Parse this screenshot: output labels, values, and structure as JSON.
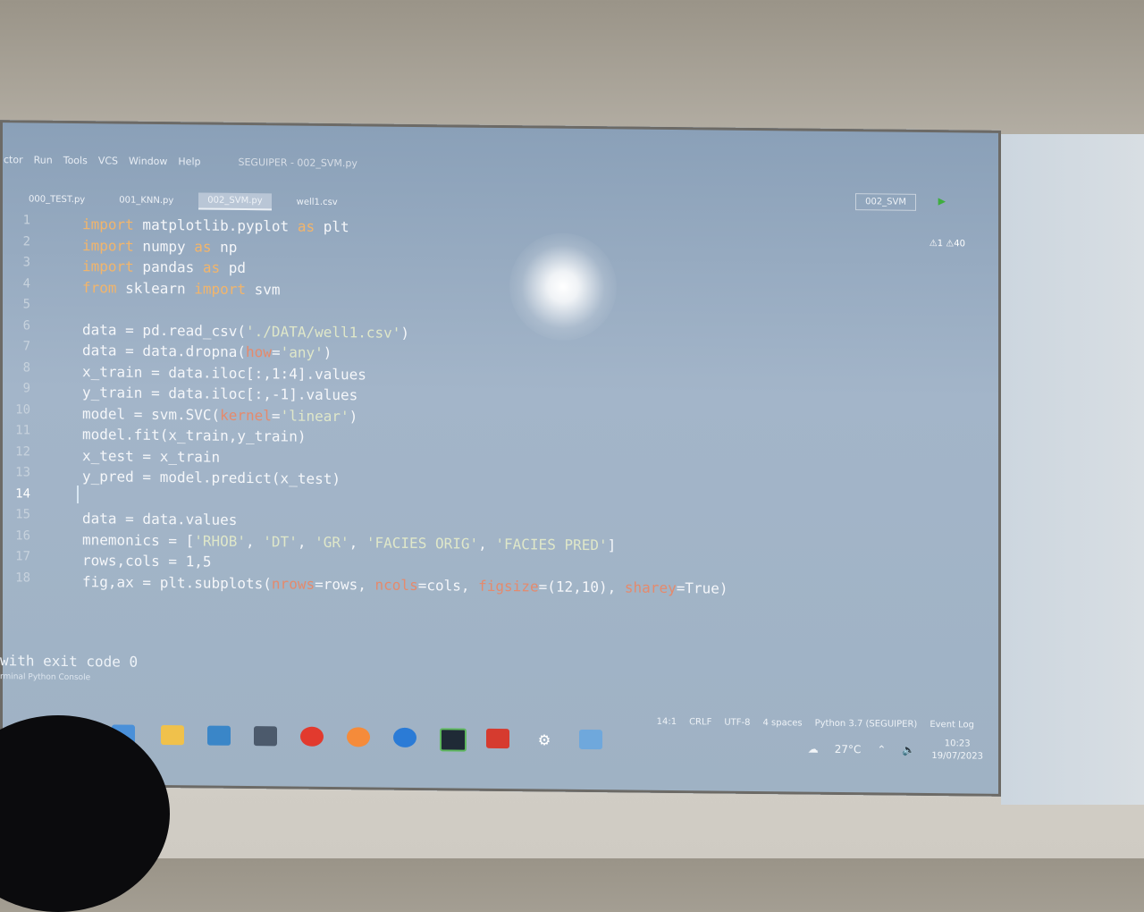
{
  "menu": [
    "ctor",
    "Run",
    "Tools",
    "VCS",
    "Window",
    "Help"
  ],
  "window_title": "SEGUIPER - 002_SVM.py",
  "tabs": [
    "000_TEST.py",
    "001_KNN.py",
    "002_SVM.py",
    "well1.csv"
  ],
  "run_config": "002_SVM",
  "warnings": "⚠1  ⚠40",
  "line_numbers": [
    "1",
    "2",
    "3",
    "4",
    "5",
    "6",
    "7",
    "8",
    "9",
    "10",
    "11",
    "12",
    "13",
    "14",
    "15",
    "16",
    "17",
    "18"
  ],
  "code_lines": [
    "import matplotlib.pyplot as plt",
    "import numpy as np",
    "import pandas as pd",
    "from sklearn import svm",
    "",
    "data = pd.read_csv('./DATA/well1.csv')",
    "data = data.dropna(how='any')",
    "x_train = data.iloc[:,1:4].values",
    "y_train = data.iloc[:,-1].values",
    "model = svm.SVC(kernel='linear')",
    "model.fit(x_train,y_train)",
    "x_test = x_train",
    "y_pred = model.predict(x_test)",
    "",
    "data = data.values",
    "mnemonics = ['RHOB', 'DT', 'GR', 'FACIES ORIG', 'FACIES PRED']",
    "rows,cols = 1,5",
    "fig,ax = plt.subplots(nrows=rows, ncols=cols, figsize=(12,10), sharey=True)"
  ],
  "console": {
    "output": "with exit code 0",
    "tabs": "rminal   Python Console"
  },
  "statusbar": [
    "14:1",
    "CRLF",
    "UTF-8",
    "4 spaces",
    "Python 3.7 (SEGUIPER)"
  ],
  "event_log": "Event Log",
  "tray": {
    "temperature": "27°C",
    "time": "10:23",
    "date": "19/07/2023"
  },
  "colors": {
    "keyword": "#f2b56b",
    "string": "#dfe7c9",
    "param": "#e58a6c",
    "screen": "#a3b5c9"
  }
}
